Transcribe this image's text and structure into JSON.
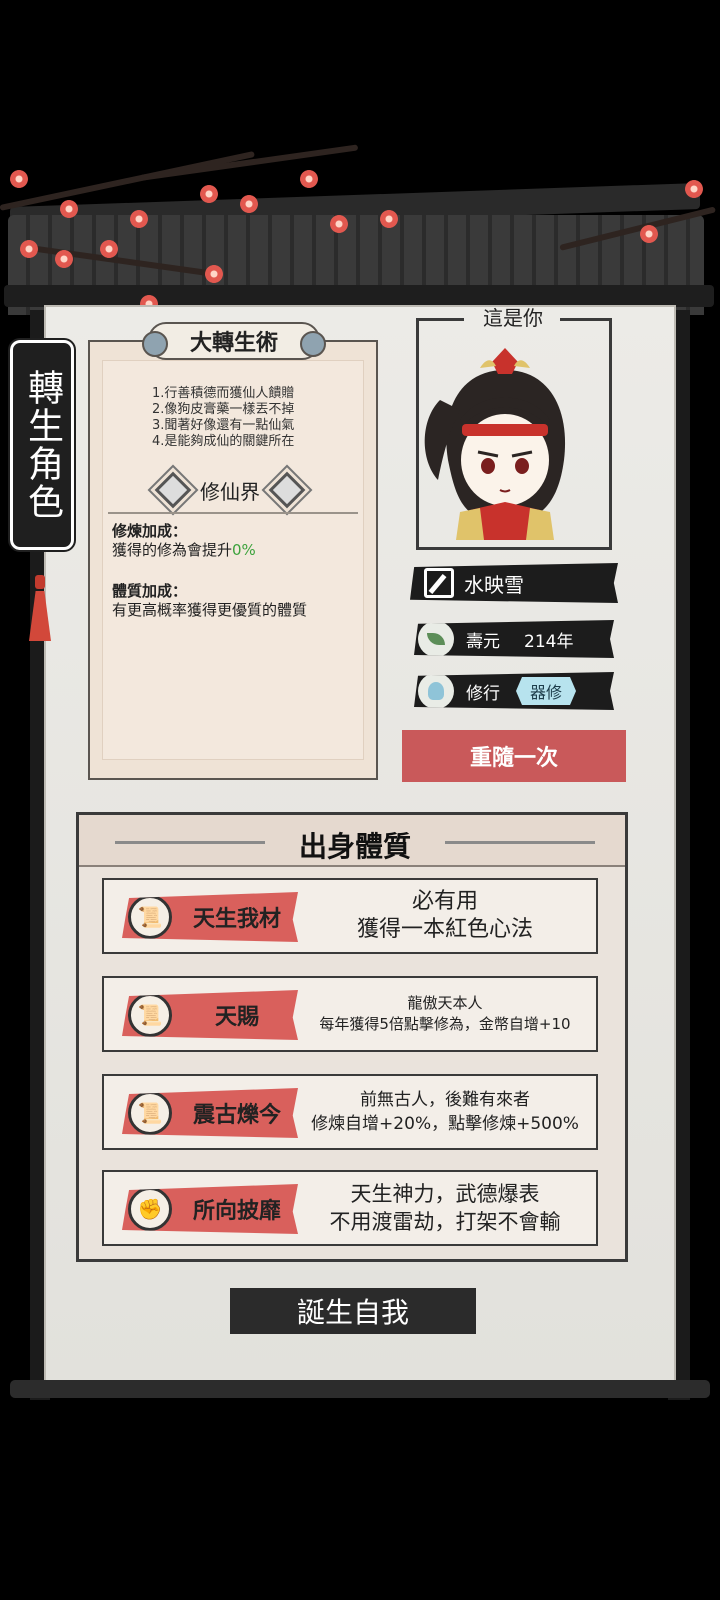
{
  "side_tag": "轉生角色",
  "scroll": {
    "title": "大轉生術",
    "rules": [
      "1.行善積德而獲仙人饋贈",
      "2.像狗皮膏藥一樣丟不掉",
      "3.聞著好像還有一點仙氣",
      "4.是能夠成仙的關鍵所在"
    ],
    "realm": "修仙界",
    "cultivation_bonus_title": "修煉加成：",
    "cultivation_bonus_text": "獲得的修為會提升",
    "cultivation_bonus_value": "0%",
    "physique_bonus_title": "體質加成：",
    "physique_bonus_text": "有更高概率獲得更優質的體質"
  },
  "portrait": {
    "label": "這是你"
  },
  "character": {
    "name": "水映雪",
    "lifespan_label": "壽元",
    "lifespan_value": "214年",
    "practice_label": "修行",
    "practice_value": "器修"
  },
  "reroll_label": "重隨一次",
  "origin": {
    "title": "出身體質",
    "traits": [
      {
        "name": "天生我材",
        "icon": "scroll-icon",
        "line1": "必有用",
        "line2": "獲得一本紅色心法"
      },
      {
        "name": "天賜",
        "icon": "scroll-icon",
        "line1": "龍傲天本人",
        "line2": "每年獲得5倍點擊修為，金幣自增+10"
      },
      {
        "name": "震古爍今",
        "icon": "scroll-icon",
        "line1": "前無古人，後難有來者",
        "line2": "修煉自增+20%，點擊修煉+500%"
      },
      {
        "name": "所向披靡",
        "icon": "fist-icon",
        "line1": "天生神力，武德爆表",
        "line2": "不用渡雷劫，打架不會輸"
      }
    ]
  },
  "born_label": "誕生自我",
  "colors": {
    "accent_red": "#c9595a",
    "tag_red": "#d9605c",
    "green": "#3ca23c",
    "badge_blue": "#b7e3ee"
  }
}
